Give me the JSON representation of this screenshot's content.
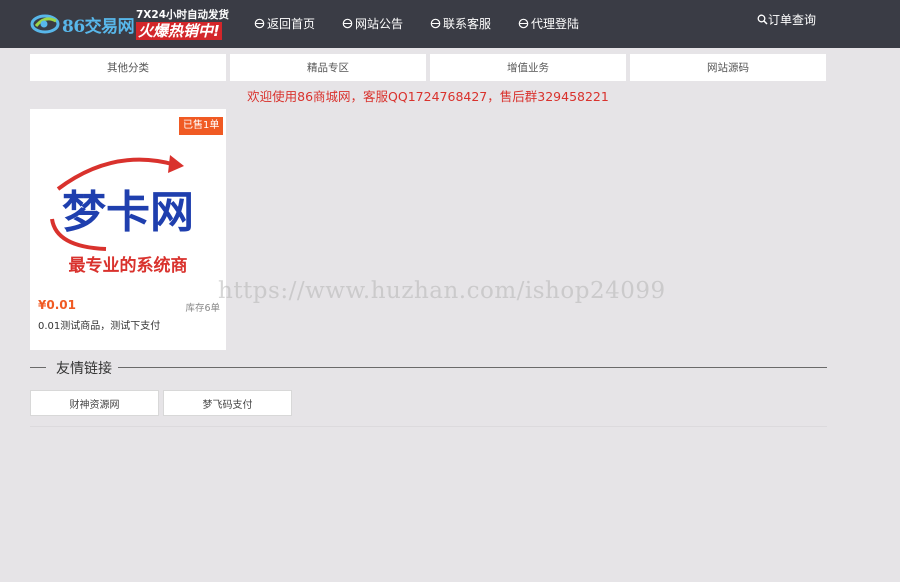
{
  "header": {
    "logo_text": "86交易网",
    "promo_line1": "7X24小时自动发货",
    "promo_line2": "火爆热销中!",
    "nav": [
      {
        "label": "返回首页",
        "icon": "refresh-icon"
      },
      {
        "label": "网站公告",
        "icon": "refresh-icon"
      },
      {
        "label": "联系客服",
        "icon": "refresh-icon"
      },
      {
        "label": "代理登陆",
        "icon": "refresh-icon"
      }
    ],
    "order_query": "订单查询"
  },
  "categories": [
    "其他分类",
    "精品专区",
    "增值业务",
    "网站源码"
  ],
  "welcome": "欢迎使用86商城网，客服QQ1724768427，售后群329458221",
  "product": {
    "badge": "已售1单",
    "image_title": "梦卡网",
    "image_slogan": "最专业的系统商",
    "price": "¥0.01",
    "stock": "库存6单",
    "name": "0.01测试商品，测试下支付"
  },
  "friend_links": {
    "title": "友情链接",
    "items": [
      "财神资源网",
      "梦飞码支付"
    ]
  },
  "watermark": "https://www.huzhan.com/ishop24099",
  "colors": {
    "header_bg": "#3a3c45",
    "accent_red": "#d9322d",
    "badge_orange": "#f05a23",
    "page_bg": "#e6e4e7"
  }
}
